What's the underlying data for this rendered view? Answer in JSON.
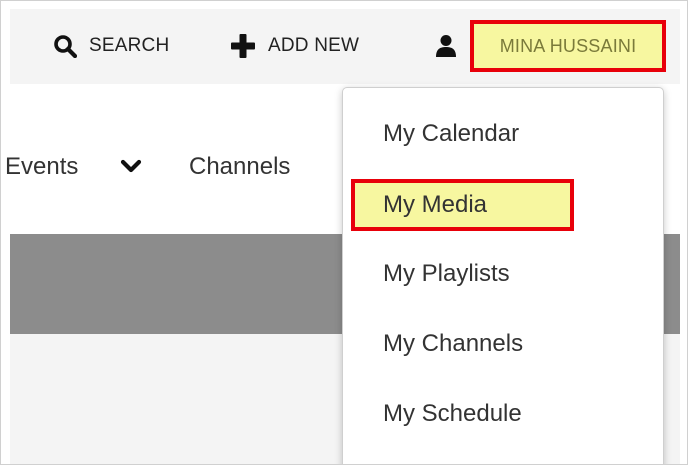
{
  "header": {
    "search_label": "SEARCH",
    "add_new_label": "ADD NEW",
    "user_name": "MINA HUSSAINI"
  },
  "nav": {
    "events_label": "Events",
    "channels_label": "Channels"
  },
  "user_menu": {
    "items": [
      {
        "label": "My Calendar"
      },
      {
        "label": "My Media",
        "highlighted": true
      },
      {
        "label": "My Playlists"
      },
      {
        "label": "My Channels"
      },
      {
        "label": "My Schedule"
      }
    ]
  },
  "colors": {
    "highlight_border": "#e8000a",
    "highlight_fill": "#f7f7a0",
    "banner": "#8c8c8c",
    "header_bg": "#f4f4f4"
  },
  "icons": {
    "search": "search-icon",
    "add": "plus-icon",
    "user": "user-icon",
    "events_dropdown": "chevron-down-icon"
  }
}
